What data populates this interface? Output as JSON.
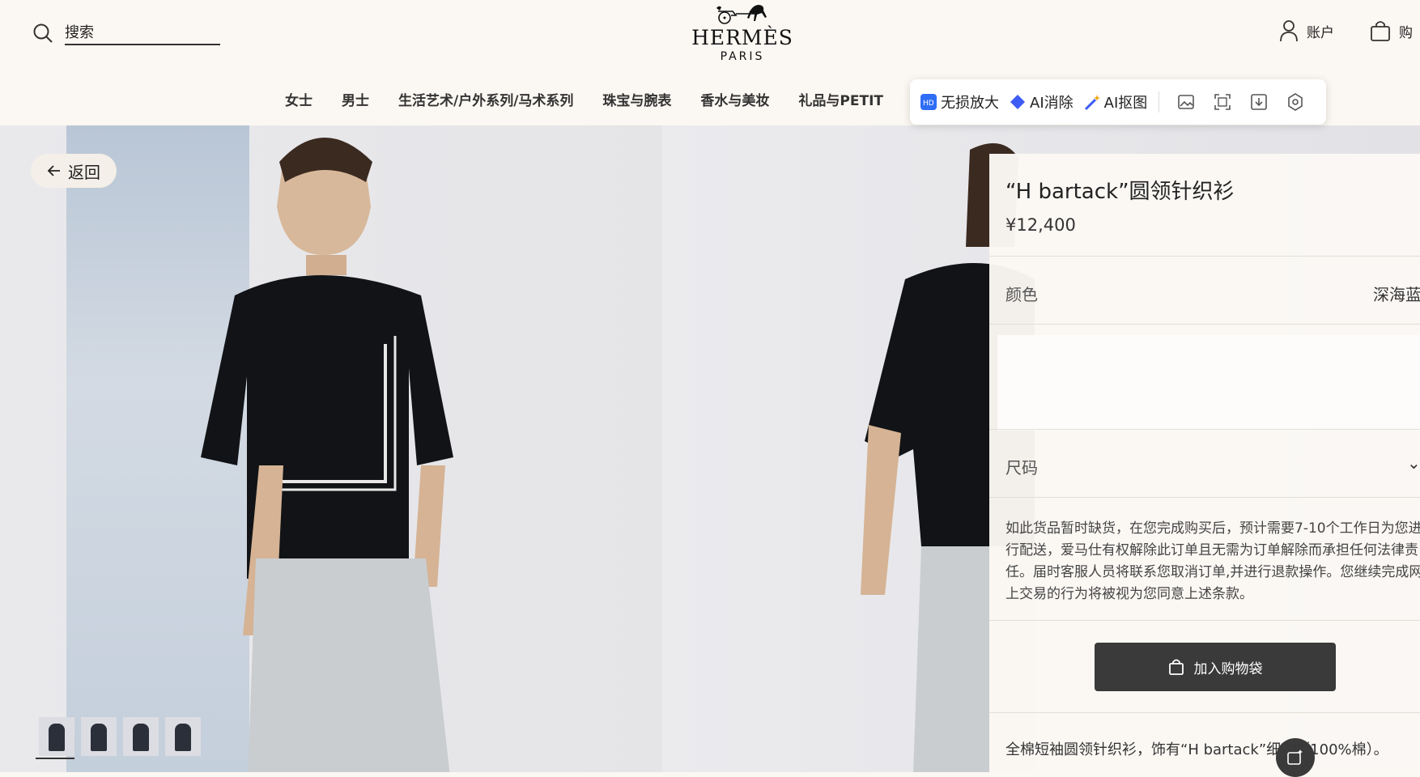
{
  "header": {
    "search_placeholder": "搜索",
    "brand": "HERMÈS",
    "brand_city": "PARIS",
    "account_label": "账户",
    "bag_label": "购"
  },
  "nav": {
    "items": [
      "女士",
      "男士",
      "生活艺术/户外系列/马术系列",
      "珠宝与腕表",
      "香水与美妆",
      "礼品与PETIT"
    ]
  },
  "ai_toolbar": {
    "lossless_zoom": "无损放大",
    "ai_erase": "AI消除",
    "ai_cutout": "AI抠图",
    "tool_icons": [
      "image-edit-icon",
      "crop-frame-icon",
      "download-icon",
      "settings-icon"
    ]
  },
  "back_label": "返回",
  "thumbnails_count": 4,
  "product": {
    "title": "“H bartack”圆领针织衫",
    "price": "¥12,400",
    "color_label": "颜色",
    "color_value": "深海蓝",
    "size_label": "尺码",
    "notice": "如此货品暂时缺货，在您完成购买后，预计需要7-10个工作日为您进行配送，爱马仕有权解除此订单且无需为订单解除而承担任何法律责任。届时客服人员将联系您取消订单,并进行退款操作。您继续完成网上交易的行为将被视为您同意上述条款。",
    "add_to_bag": "加入购物袋",
    "description": "全棉短袖圆领针织衫，饰有“H bartack”细节（100%棉）。"
  },
  "colors": {
    "background": "#fbf7f2",
    "button": "#3a3a3a"
  }
}
